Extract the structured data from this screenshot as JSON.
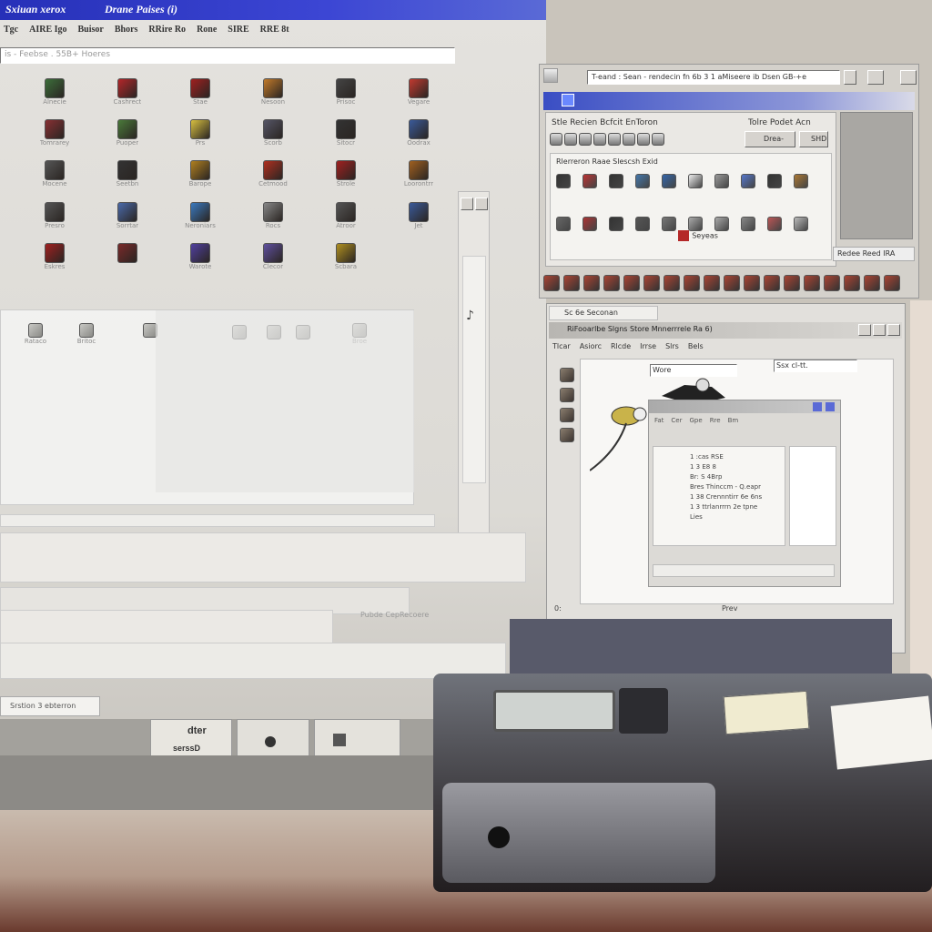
{
  "left_window": {
    "title": "Sxiuan xerox",
    "title2": "Drane Paises (i)",
    "menu": [
      "Tgc",
      "AIRE Igo",
      "Buisor",
      "Bhors",
      "RRire Ro",
      "Rone",
      "SIRE",
      "RRE 8t"
    ],
    "address": "is - Feebse . 55B+ Hoeres",
    "icons": [
      {
        "label": "Alnecie",
        "icon": "folder-icon",
        "color": "#3c6e3a"
      },
      {
        "label": "Cashrect",
        "icon": "camera-icon",
        "color": "#b4262a"
      },
      {
        "label": "Stae",
        "icon": "mouse-icon",
        "color": "#a02020"
      },
      {
        "label": "Nesoon",
        "icon": "monitor-icon",
        "color": "#c27a2a"
      },
      {
        "label": "Prisoc",
        "icon": "printer-icon",
        "color": "#444"
      },
      {
        "label": "Vegare",
        "icon": "cd-icon",
        "color": "#c23a30"
      },
      {
        "label": "Tomrarey",
        "icon": "book-icon",
        "color": "#883033"
      },
      {
        "label": "Puoper",
        "icon": "chip-icon",
        "color": "#4a7a3a"
      },
      {
        "label": "Prs",
        "icon": "paint-icon",
        "color": "#d8c040"
      },
      {
        "label": "Scorb",
        "icon": "disk-icon",
        "color": "#556"
      },
      {
        "label": "Sitocr",
        "icon": "server-icon",
        "color": "#333"
      },
      {
        "label": "Oodrax",
        "icon": "globe-icon",
        "color": "#3a5a9a"
      },
      {
        "label": "Mocene",
        "icon": "drive-icon",
        "color": "#555"
      },
      {
        "label": "Seetbn",
        "icon": "tv-icon",
        "color": "#333"
      },
      {
        "label": "Barope",
        "icon": "tools-icon",
        "color": "#b08020"
      },
      {
        "label": "Cetmood",
        "icon": "car-icon",
        "color": "#b03020"
      },
      {
        "label": "Strole",
        "icon": "rocket-icon",
        "color": "#a02020"
      },
      {
        "label": "Loorontrr",
        "icon": "film-icon",
        "color": "#a06020"
      },
      {
        "label": "Presro",
        "icon": "shield-icon",
        "color": "#555"
      },
      {
        "label": "Sorrtar",
        "icon": "window-icon",
        "color": "#4a6aaa"
      },
      {
        "label": "Neroniars",
        "icon": "screen-icon",
        "color": "#3a7ac0"
      },
      {
        "label": "Rocs",
        "icon": "cloud-icon",
        "color": "#888"
      },
      {
        "label": "Atroor",
        "icon": "gun-icon",
        "color": "#555"
      },
      {
        "label": "Jet",
        "icon": "terminal-icon",
        "color": "#3a5a9a"
      },
      {
        "label": "Eskres",
        "icon": "cup-icon",
        "color": "#a02020"
      },
      {
        "label": "",
        "icon": "spider-icon",
        "color": "#7a2a2a"
      },
      {
        "label": "Warote",
        "icon": "pen-icon",
        "color": "#5040a0"
      },
      {
        "label": "Clecor",
        "icon": "gear-icon",
        "color": "#6050a0"
      },
      {
        "label": "Scbara",
        "icon": "box-icon",
        "color": "#b09020"
      }
    ],
    "inner_icons": [
      {
        "label": "Rataco",
        "icon": "doc-icon"
      },
      {
        "label": "Britoc",
        "icon": "doc-icon"
      },
      {
        "label": "",
        "icon": "file-icon"
      },
      {
        "label": "",
        "icon": "file-icon"
      },
      {
        "label": "",
        "icon": "file-icon"
      },
      {
        "label": "",
        "icon": "file-icon"
      },
      {
        "label": "Broe",
        "icon": "file-icon"
      }
    ],
    "bottom_label": "Pubde CepRecoere",
    "status": "Srstion 3 ebterron",
    "taskbar_text": [
      "dter",
      "ie",
      "serssD"
    ]
  },
  "right_top_window": {
    "address_text": "T-eand : Sean - rendecin fn 6b 3 1 aMiseere ib Dsen GB-+e",
    "panel_title": "Stle Recien Bcfcit EnToron",
    "panel_title2": "Tolre Podet Acn",
    "panel_btn": "Drea-",
    "panel_btn2": "SHD",
    "section_title": "Rlerreron Raae Slescsh Exid",
    "button_label": "Seyeas",
    "status_label": "Redee  Reed IRA",
    "toolbar_count": 18
  },
  "right_bottom_window": {
    "title": "Sc 6e Seconan",
    "subtitle": "RiFooarlbe Slgns Store Mnnerrrele Ra 6)",
    "menu": [
      "Tlcar",
      "Asiorc",
      "Rlcde",
      "Irrse",
      "Slrs",
      "Bels"
    ],
    "dropdown1": "Wore",
    "dropdown2": "Ssx cl-tt.",
    "inner_menu": [
      "Fat",
      "Cer",
      "Gpe",
      "Rre",
      "Bm"
    ],
    "inner_rows": [
      "1 :cas RSE",
      "1 3 E8 8",
      "Br: S 4Brp",
      "Bres Thinccm - Q.eapr",
      "1 38 Crennntirr 6e 6ns",
      "1 3 ttrlanrrrn 2e tpne",
      "Lies"
    ],
    "status_left": "0:",
    "status_right": "Prev"
  }
}
